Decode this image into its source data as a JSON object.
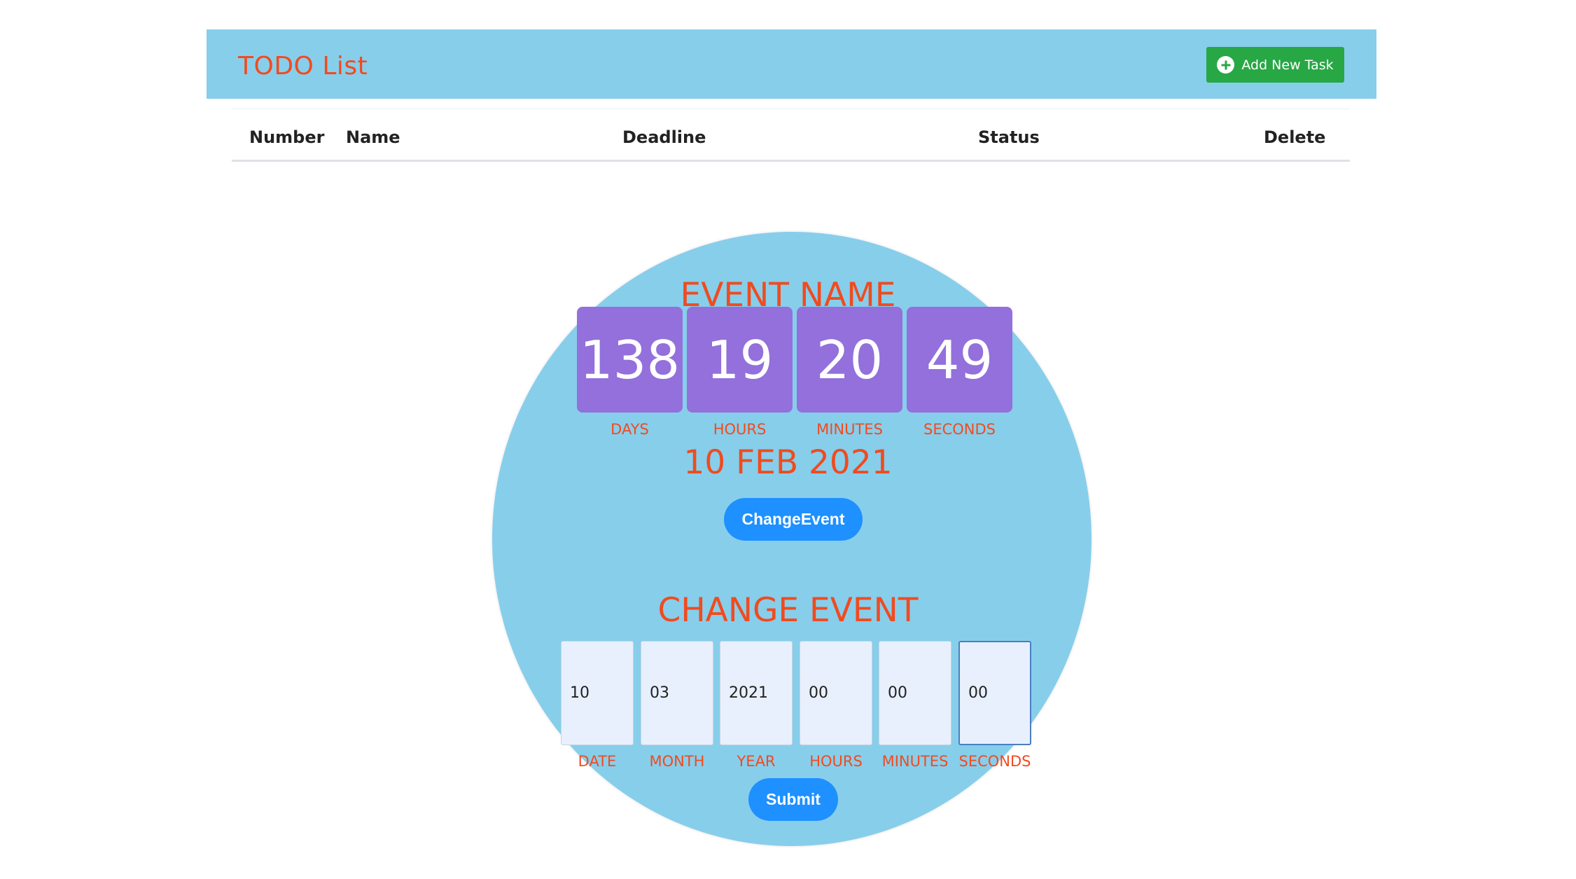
{
  "header": {
    "title": "TODO List",
    "add_task_label": "Add New Task"
  },
  "table": {
    "columns": [
      "Number",
      "Name",
      "Deadline",
      "Status",
      "Delete"
    ],
    "rows": []
  },
  "countdown": {
    "event_name": "EVENT NAME",
    "values": {
      "days": "138",
      "hours": "19",
      "minutes": "20",
      "seconds": "49"
    },
    "labels": {
      "days": "DAYS",
      "hours": "HOURS",
      "minutes": "MINUTES",
      "seconds": "SECONDS"
    },
    "event_date": "10 FEB 2021",
    "change_button_label": "ChangeEvent"
  },
  "change_event_form": {
    "heading": "CHANGE EVENT",
    "fields": {
      "date": {
        "value": "10",
        "label": "DATE"
      },
      "month": {
        "value": "03",
        "label": "MONTH"
      },
      "year": {
        "value": "2021",
        "label": "YEAR"
      },
      "hours": {
        "value": "00",
        "label": "HOURS"
      },
      "minutes": {
        "value": "00",
        "label": "MINUTES"
      },
      "seconds": {
        "value": "00",
        "label": "SECONDS"
      }
    },
    "submit_label": "Submit"
  },
  "colors": {
    "header_bg": "#87ceeb",
    "accent_text": "#f04b1f",
    "add_button": "#28a745",
    "timer_box": "#9370db",
    "primary_button": "#1e90ff",
    "input_bg": "#e8f0fe"
  },
  "icons": {
    "add_task": "plus-circle-icon"
  }
}
